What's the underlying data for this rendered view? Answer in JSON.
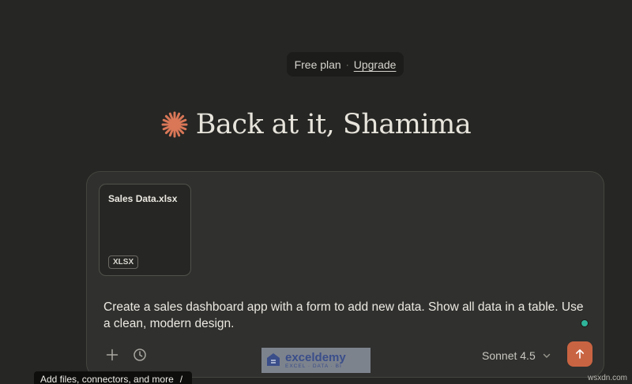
{
  "plan": {
    "label": "Free plan",
    "separator": "·",
    "upgrade_label": "Upgrade"
  },
  "greeting": {
    "text": "Back at it, Shamima"
  },
  "attachment": {
    "file_name": "Sales Data.xlsx",
    "file_type": "XLSX"
  },
  "composer": {
    "prompt_text": "Create a sales dashboard app with a form to add new data. Show all data in a table. Use a clean, modern design."
  },
  "toolbar": {
    "add_icon": "plus-icon",
    "history_icon": "clock-icon",
    "model_label": "Sonnet 4.5",
    "send_icon": "arrow-up-icon"
  },
  "tooltip": {
    "text": "Add files, connectors, and more",
    "shortcut": "/"
  },
  "watermark": {
    "name": "exceldemy",
    "tagline": "EXCEL · DATA · BI"
  },
  "source_mark": "wsxdn.com",
  "colors": {
    "background": "#262624",
    "accent": "#c96442",
    "status": "#2fb49a"
  }
}
